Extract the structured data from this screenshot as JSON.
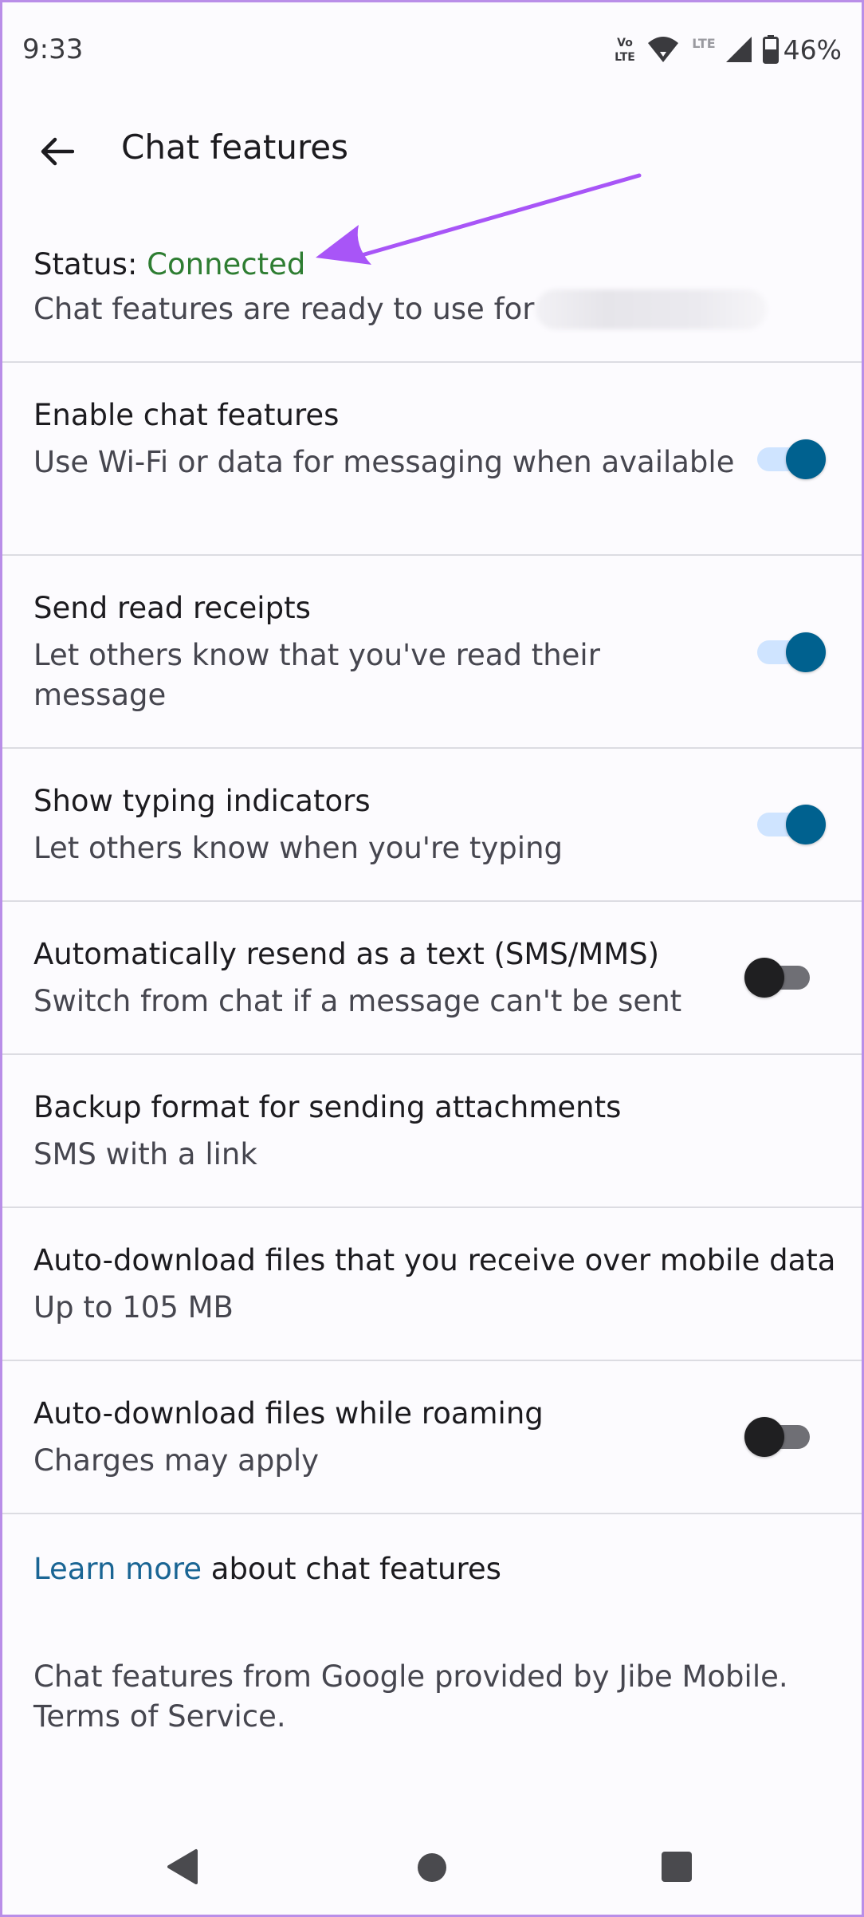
{
  "status_bar": {
    "time": "9:33",
    "volte_label": "Vo LTE",
    "lte_label": "LTE",
    "battery_percent": "46%"
  },
  "app_bar": {
    "title": "Chat features"
  },
  "status": {
    "label": "Status:",
    "value": "Connected",
    "description": "Chat features are ready to use for",
    "value_color": "#2e7d32"
  },
  "settings": [
    {
      "title": "Enable chat features",
      "subtitle": "Use Wi-Fi or data for messaging when available",
      "toggle": true
    },
    {
      "title": "Send read receipts",
      "subtitle": "Let others know that you've read their message",
      "toggle": true
    },
    {
      "title": "Show typing indicators",
      "subtitle": "Let others know when you're typing",
      "toggle": true
    },
    {
      "title": "Automatically resend as a text (SMS/MMS)",
      "subtitle": "Switch from chat if a message can't be sent",
      "toggle": false
    },
    {
      "title": "Backup format for sending attachments",
      "subtitle": "SMS with a link"
    },
    {
      "title": "Auto-download files that you receive over mobile data",
      "subtitle": "Up to 105 MB"
    },
    {
      "title": "Auto-download files while roaming",
      "subtitle": "Charges may apply",
      "toggle": false
    }
  ],
  "learn_more": {
    "link": "Learn more",
    "rest": " about chat features"
  },
  "footer": {
    "text": "Chat features from Google provided by Jibe Mobile. Terms of Service."
  },
  "colors": {
    "accent": "#00618f",
    "link": "#1a6594",
    "annotation_arrow": "#a855f7"
  }
}
